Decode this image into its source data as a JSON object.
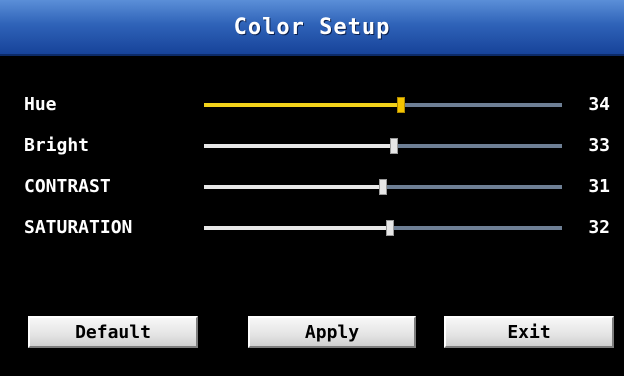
{
  "window": {
    "title": "Color Setup"
  },
  "settings": [
    {
      "label": "Hue",
      "value": "34",
      "level": 0.55,
      "active": true
    },
    {
      "label": "Bright",
      "value": "33",
      "level": 0.53,
      "active": false
    },
    {
      "label": "CONTRAST",
      "value": "31",
      "level": 0.5,
      "active": false
    },
    {
      "label": "SATURATION",
      "value": "32",
      "level": 0.52,
      "active": false
    }
  ],
  "buttons": {
    "default_label": "Default",
    "apply_label": "Apply",
    "exit_label": "Exit"
  },
  "colors": {
    "title_bar": "#2f63b8",
    "active_slider": "#f2d21a",
    "background": "#000000"
  }
}
